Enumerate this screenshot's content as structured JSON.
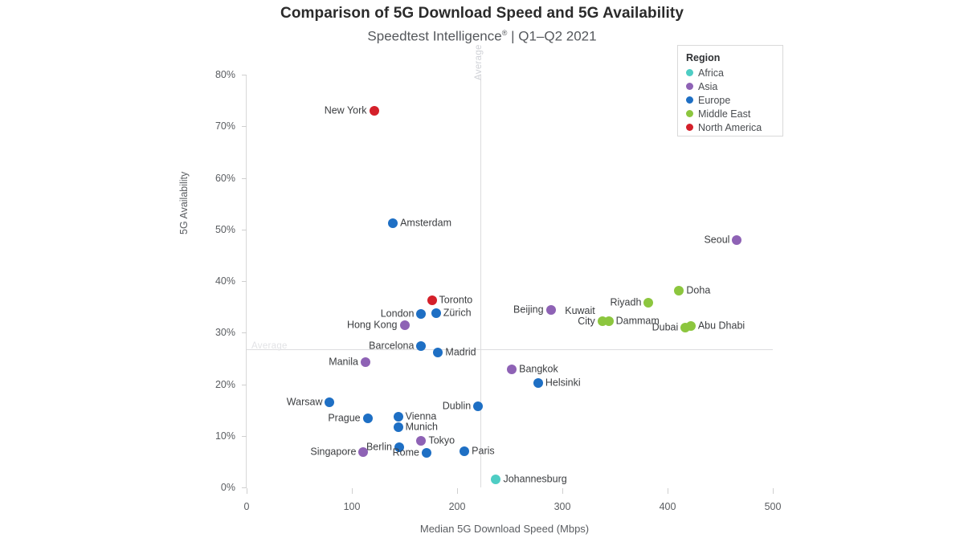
{
  "chart_data": {
    "type": "scatter",
    "title": "Comparison of 5G Download Speed and 5G Availability",
    "subtitle_prefix": "Speedtest Intelligence",
    "subtitle_mark": "®",
    "subtitle_suffix": " | Q1–Q2 2021",
    "xlabel": "Median 5G Download Speed (Mbps)",
    "ylabel": "5G Availability",
    "xlim": [
      0,
      500
    ],
    "ylim": [
      0,
      80
    ],
    "xticks": [
      0,
      100,
      200,
      300,
      400,
      500
    ],
    "xtick_labels": [
      "0",
      "100",
      "200",
      "300",
      "400",
      "500"
    ],
    "yticks": [
      0,
      10,
      20,
      30,
      40,
      50,
      60,
      70,
      80
    ],
    "ytick_labels": [
      "0%",
      "10%",
      "20%",
      "30%",
      "40%",
      "50%",
      "60%",
      "70%",
      "80%"
    ],
    "grid": false,
    "legend_position": "top-right",
    "reference_lines": [
      {
        "name": "average-availability",
        "orientation": "horizontal",
        "label": "Average",
        "value": 26.8
      },
      {
        "name": "average-speed",
        "orientation": "vertical",
        "label": "Average",
        "value": 222
      }
    ],
    "legend": {
      "title": "Region",
      "entries": [
        {
          "label": "Africa",
          "color": "#4ECDC4"
        },
        {
          "label": "Asia",
          "color": "#8E62B5"
        },
        {
          "label": "Europe",
          "color": "#1E6FC4"
        },
        {
          "label": "Middle East",
          "color": "#8CC63E"
        },
        {
          "label": "North America",
          "color": "#D4202A"
        }
      ]
    },
    "points": [
      {
        "city": "New York",
        "region": "North America",
        "speed": 121,
        "availability": 73.0,
        "label_side": "left"
      },
      {
        "city": "Amsterdam",
        "region": "Europe",
        "speed": 139,
        "availability": 51.2,
        "label_side": "right"
      },
      {
        "city": "Seoul",
        "region": "Asia",
        "speed": 466,
        "availability": 48.0,
        "label_side": "left"
      },
      {
        "city": "Doha",
        "region": "Middle East",
        "speed": 411,
        "availability": 38.1,
        "label_side": "right"
      },
      {
        "city": "Toronto",
        "region": "North America",
        "speed": 176,
        "availability": 36.3,
        "label_side": "right"
      },
      {
        "city": "Riyadh",
        "region": "Middle East",
        "speed": 382,
        "availability": 35.8,
        "label_side": "left"
      },
      {
        "city": "Zürich",
        "region": "Europe",
        "speed": 180,
        "availability": 33.7,
        "label_side": "right"
      },
      {
        "city": "London",
        "region": "Europe",
        "speed": 166,
        "availability": 33.6,
        "label_side": "left"
      },
      {
        "city": "Beijing",
        "region": "Asia",
        "speed": 289,
        "availability": 34.4,
        "label_side": "left"
      },
      {
        "city": "Hong Kong",
        "region": "Asia",
        "speed": 150,
        "availability": 31.4,
        "label_side": "left"
      },
      {
        "city": "Kuwait City",
        "region": "Middle East",
        "speed": 338,
        "availability": 32.2,
        "label_side": "left-2line"
      },
      {
        "city": "Dammam",
        "region": "Middle East",
        "speed": 344,
        "availability": 32.2,
        "label_side": "right"
      },
      {
        "city": "Abu Dhabi",
        "region": "Middle East",
        "speed": 422,
        "availability": 31.3,
        "label_side": "right"
      },
      {
        "city": "Dubai",
        "region": "Middle East",
        "speed": 417,
        "availability": 30.9,
        "label_side": "left"
      },
      {
        "city": "Barcelona",
        "region": "Europe",
        "speed": 166,
        "availability": 27.4,
        "label_side": "left"
      },
      {
        "city": "Madrid",
        "region": "Europe",
        "speed": 182,
        "availability": 26.1,
        "label_side": "right"
      },
      {
        "city": "Manila",
        "region": "Asia",
        "speed": 113,
        "availability": 24.3,
        "label_side": "left"
      },
      {
        "city": "Bangkok",
        "region": "Asia",
        "speed": 252,
        "availability": 22.9,
        "label_side": "right"
      },
      {
        "city": "Helsinki",
        "region": "Europe",
        "speed": 277,
        "availability": 20.2,
        "label_side": "right"
      },
      {
        "city": "Dublin",
        "region": "Europe",
        "speed": 220,
        "availability": 15.7,
        "label_side": "left"
      },
      {
        "city": "Warsaw",
        "region": "Europe",
        "speed": 79,
        "availability": 16.5,
        "label_side": "left"
      },
      {
        "city": "Vienna",
        "region": "Europe",
        "speed": 144,
        "availability": 13.7,
        "label_side": "right"
      },
      {
        "city": "Prague",
        "region": "Europe",
        "speed": 115,
        "availability": 13.4,
        "label_side": "left"
      },
      {
        "city": "Munich",
        "region": "Europe",
        "speed": 144,
        "availability": 11.7,
        "label_side": "right"
      },
      {
        "city": "Tokyo",
        "region": "Asia",
        "speed": 166,
        "availability": 9.0,
        "label_side": "right"
      },
      {
        "city": "Berlin",
        "region": "Europe",
        "speed": 145,
        "availability": 7.8,
        "label_side": "left"
      },
      {
        "city": "Rome",
        "region": "Europe",
        "speed": 171,
        "availability": 6.7,
        "label_side": "left"
      },
      {
        "city": "Paris",
        "region": "Europe",
        "speed": 207,
        "availability": 7.0,
        "label_side": "right"
      },
      {
        "city": "Singapore",
        "region": "Asia",
        "speed": 111,
        "availability": 6.9,
        "label_side": "left"
      },
      {
        "city": "Johannesburg",
        "region": "Africa",
        "speed": 237,
        "availability": 1.6,
        "label_side": "right"
      }
    ]
  }
}
